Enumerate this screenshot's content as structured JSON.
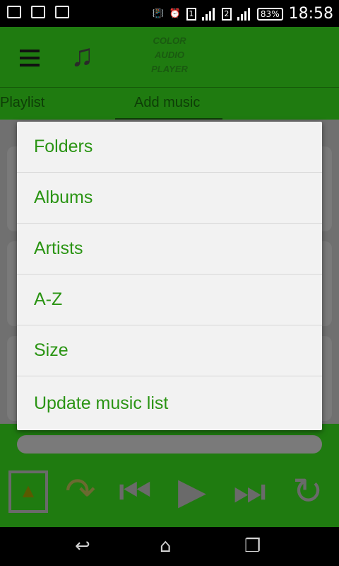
{
  "status_bar": {
    "sim1": "1",
    "sim2": "2",
    "battery": "83%",
    "time": "18:58",
    "icons": [
      "image-icon",
      "sim-card-icon",
      "chat-icon",
      "vibrate-icon",
      "alarm-icon"
    ]
  },
  "app_bar": {
    "logo_text": [
      "COLOR",
      "AUDIO",
      "PLAYER"
    ]
  },
  "tabs": [
    {
      "label": "Playlist"
    },
    {
      "label": "Add music"
    }
  ],
  "menu": {
    "items": [
      {
        "label": "Folders"
      },
      {
        "label": "Albums"
      },
      {
        "label": "Artists"
      },
      {
        "label": "A-Z"
      },
      {
        "label": "Size"
      },
      {
        "label": "Update music list"
      }
    ]
  },
  "colors": {
    "app_green": "#1f7b10",
    "menu_text": "#2a9413",
    "menu_bg": "#f2f2f2"
  }
}
